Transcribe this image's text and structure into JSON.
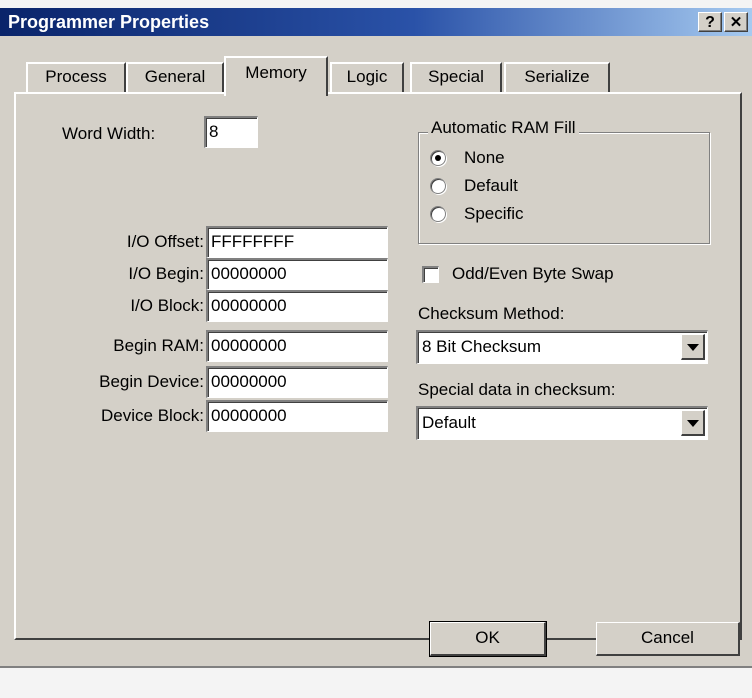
{
  "window": {
    "title": "Programmer Properties",
    "help_label": "?",
    "close_label": "✕",
    "title_bar_color": "#0a246a"
  },
  "tabs": [
    {
      "label": "Process",
      "active": false
    },
    {
      "label": "General",
      "active": false
    },
    {
      "label": "Memory",
      "active": true
    },
    {
      "label": "Logic",
      "active": false
    },
    {
      "label": "Special",
      "active": false
    },
    {
      "label": "Serialize",
      "active": false
    }
  ],
  "memory": {
    "word_width": {
      "label": "Word Width:",
      "value": "8"
    },
    "fields": [
      {
        "label": "I/O Offset:",
        "value": "FFFFFFFF"
      },
      {
        "label": "I/O Begin:",
        "value": "00000000"
      },
      {
        "label": "I/O Block:",
        "value": "00000000"
      },
      {
        "label": "Begin RAM:",
        "value": "00000000"
      },
      {
        "label": "Begin Device:",
        "value": "00000000"
      },
      {
        "label": "Device Block:",
        "value": "00000000"
      }
    ],
    "ram_fill": {
      "title": "Automatic RAM Fill",
      "options": [
        {
          "label": "None",
          "selected": true
        },
        {
          "label": "Default",
          "selected": false
        },
        {
          "label": "Specific",
          "selected": false
        }
      ]
    },
    "byte_swap": {
      "label": "Odd/Even Byte Swap",
      "checked": false
    },
    "checksum_method": {
      "label": "Checksum Method:",
      "value": "8 Bit Checksum"
    },
    "special_data": {
      "label": "Special data in checksum:",
      "value": "Default"
    }
  },
  "buttons": {
    "ok": "OK",
    "cancel": "Cancel"
  }
}
